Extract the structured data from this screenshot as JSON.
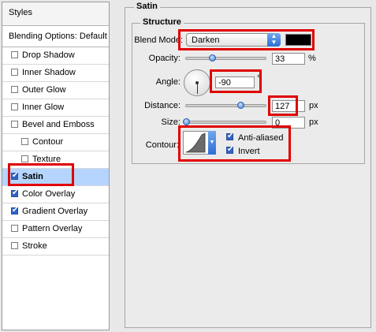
{
  "styles_panel": {
    "header": "Styles",
    "blending_options": "Blending Options: Default",
    "items": [
      {
        "label": "Drop Shadow",
        "checked": false
      },
      {
        "label": "Inner Shadow",
        "checked": false
      },
      {
        "label": "Outer Glow",
        "checked": false
      },
      {
        "label": "Inner Glow",
        "checked": false
      },
      {
        "label": "Bevel and Emboss",
        "checked": false
      },
      {
        "label": "Contour",
        "checked": false
      },
      {
        "label": "Texture",
        "checked": false
      },
      {
        "label": "Satin",
        "checked": true
      },
      {
        "label": "Color Overlay",
        "checked": true
      },
      {
        "label": "Gradient Overlay",
        "checked": true
      },
      {
        "label": "Pattern Overlay",
        "checked": false
      },
      {
        "label": "Stroke",
        "checked": false
      }
    ]
  },
  "satin": {
    "title": "Satin",
    "structure_title": "Structure",
    "blend_mode": {
      "label": "Blend Mode:",
      "value": "Darken",
      "color": "#000000"
    },
    "opacity": {
      "label": "Opacity:",
      "value": "33",
      "unit": "%",
      "level": 33
    },
    "angle": {
      "label": "Angle:",
      "value": "-90",
      "unit": "°"
    },
    "distance": {
      "label": "Distance:",
      "value": "127",
      "unit": "px",
      "level": 0.51
    },
    "size": {
      "label": "Size:",
      "value": "0",
      "unit": "px",
      "level": 0
    },
    "contour": {
      "label": "Contour:"
    },
    "anti_aliased": {
      "label": "Anti-aliased",
      "checked": true
    },
    "invert": {
      "label": "Invert",
      "checked": true
    }
  },
  "highlight_color": "#e00000"
}
